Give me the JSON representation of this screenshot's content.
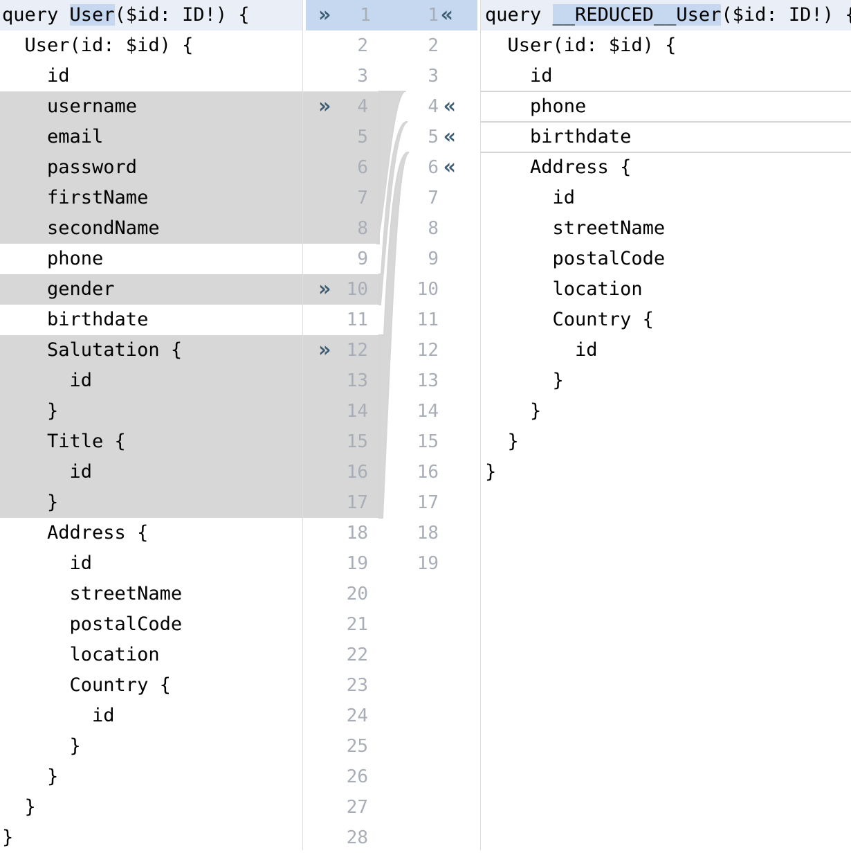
{
  "left": {
    "lines": [
      {
        "pre": "query ",
        "hl": "User",
        "post": "($id: ID!) {"
      },
      {
        "text": "  User(id: $id) {"
      },
      {
        "text": "    id"
      },
      {
        "text": "    username"
      },
      {
        "text": "    email"
      },
      {
        "text": "    password"
      },
      {
        "text": "    firstName"
      },
      {
        "text": "    secondName"
      },
      {
        "text": "    phone"
      },
      {
        "text": "    gender"
      },
      {
        "text": "    birthdate"
      },
      {
        "text": "    Salutation {"
      },
      {
        "text": "      id"
      },
      {
        "text": "    }"
      },
      {
        "text": "    Title {"
      },
      {
        "text": "      id"
      },
      {
        "text": "    }"
      },
      {
        "text": "    Address {"
      },
      {
        "text": "      id"
      },
      {
        "text": "      streetName"
      },
      {
        "text": "      postalCode"
      },
      {
        "text": "      location"
      },
      {
        "text": "      Country {"
      },
      {
        "text": "        id"
      },
      {
        "text": "      }"
      },
      {
        "text": "    }"
      },
      {
        "text": "  }"
      },
      {
        "text": "}"
      }
    ],
    "line_numbers": [
      "1",
      "2",
      "3",
      "4",
      "5",
      "6",
      "7",
      "8",
      "9",
      "10",
      "11",
      "12",
      "13",
      "14",
      "15",
      "16",
      "17",
      "18",
      "19",
      "20",
      "21",
      "22",
      "23",
      "24",
      "25",
      "26",
      "27",
      "28"
    ],
    "removed_blocks": [
      "4-8",
      "10",
      "12-17"
    ]
  },
  "right": {
    "lines": [
      {
        "pre": "query ",
        "hl": "__REDUCED__User",
        "post": "($id: ID!) {"
      },
      {
        "text": "  User(id: $id) {"
      },
      {
        "text": "    id"
      },
      {
        "text": "    phone"
      },
      {
        "text": "    birthdate"
      },
      {
        "text": "    Address {"
      },
      {
        "text": "      id"
      },
      {
        "text": "      streetName"
      },
      {
        "text": "      postalCode"
      },
      {
        "text": "      location"
      },
      {
        "text": "      Country {"
      },
      {
        "text": "        id"
      },
      {
        "text": "      }"
      },
      {
        "text": "    }"
      },
      {
        "text": "  }"
      },
      {
        "text": "}"
      }
    ],
    "line_numbers": [
      "1",
      "2",
      "3",
      "4",
      "5",
      "6",
      "7",
      "8",
      "9",
      "10",
      "11",
      "12",
      "13",
      "14",
      "15",
      "16",
      "17",
      "18",
      "19"
    ]
  },
  "arrows": {
    "left_glyph": "»",
    "right_glyph": "«",
    "left_rows": [
      1,
      4,
      10,
      12
    ],
    "right_rows": [
      1,
      4,
      5,
      6
    ]
  },
  "colors": {
    "removed_bg": "#d7d7d7",
    "selection_bg": "#c5d8f0",
    "current_line_bg": "#e9eef7",
    "arrow": "#3d5d73",
    "line_number": "#a8adb6"
  }
}
